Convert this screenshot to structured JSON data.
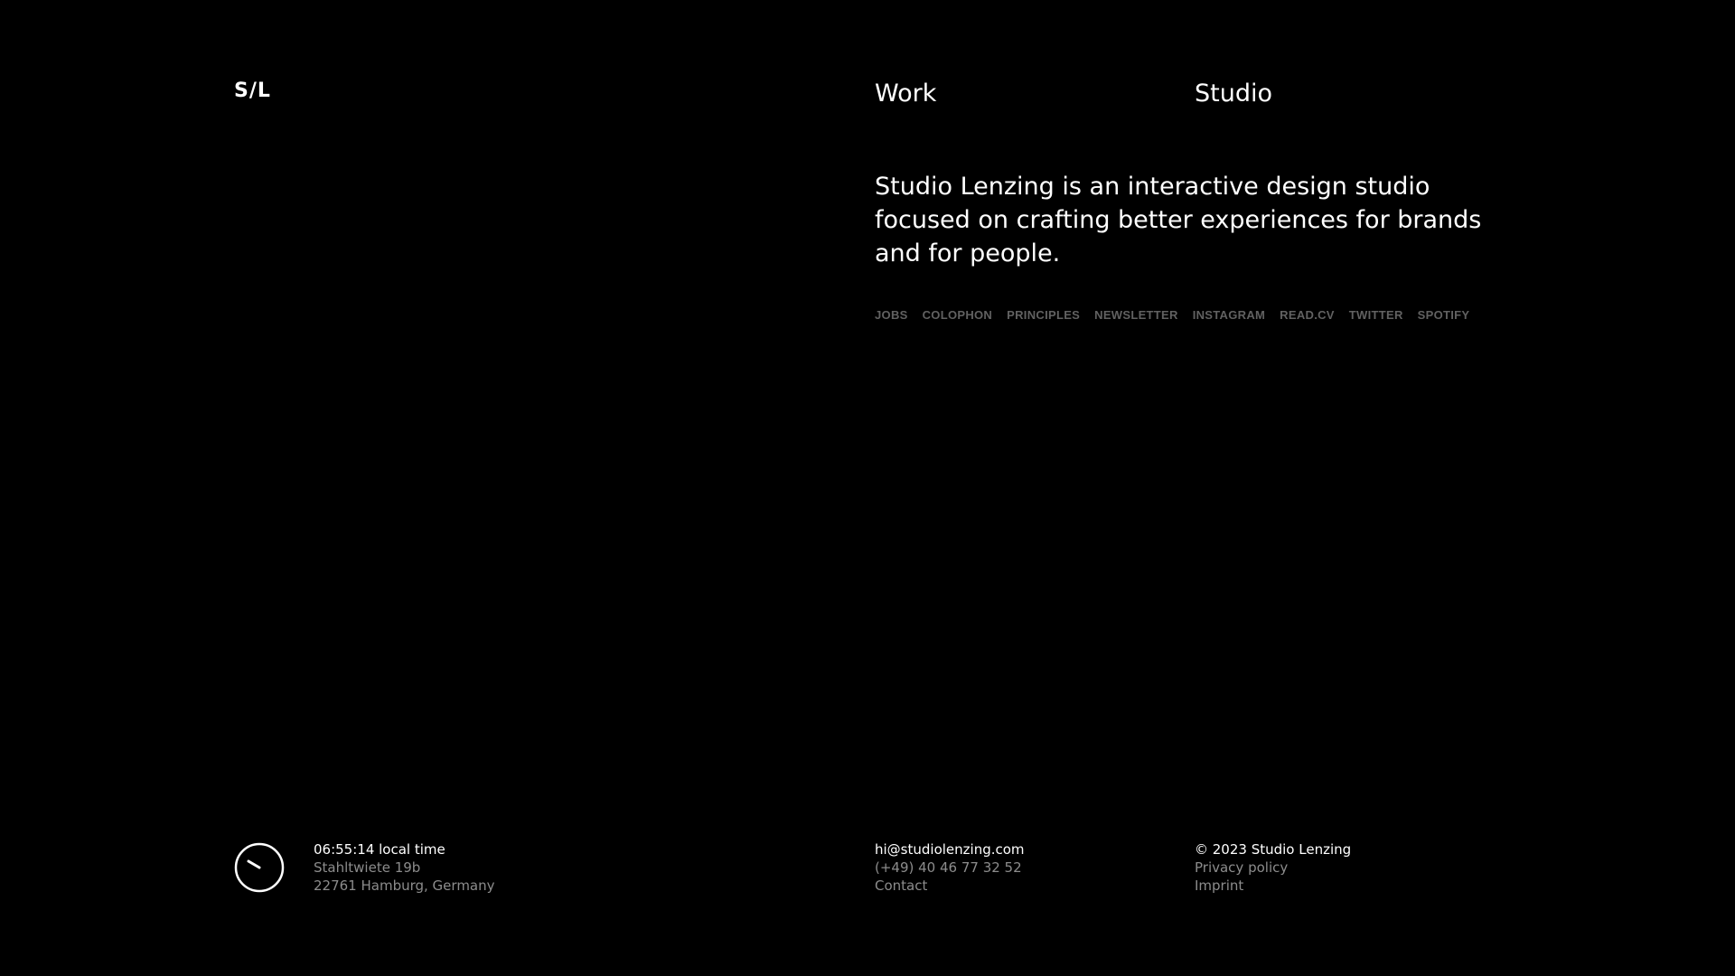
{
  "header": {
    "logo": "S/L",
    "nav": [
      {
        "label": "Work"
      },
      {
        "label": "Studio"
      }
    ]
  },
  "intro": {
    "text": "Studio Lenzing is an interactive design studio focused on crafting better experiences for brands and for people."
  },
  "links": [
    {
      "label": "JOBS"
    },
    {
      "label": "COLOPHON"
    },
    {
      "label": "PRINCIPLES"
    },
    {
      "label": "NEWSLETTER"
    },
    {
      "label": "INSTAGRAM"
    },
    {
      "label": "READ.CV"
    },
    {
      "label": "TWITTER"
    },
    {
      "label": "SPOTIFY"
    }
  ],
  "footer": {
    "clock_icon": "clock-icon",
    "time": "06:55:14 local time",
    "address_line1": "Stahltwiete 19b",
    "address_line2": "22761 Hamburg, Germany",
    "email": "hi@studiolenzing.com",
    "phone": "(+49) 40 46 77 32 52",
    "contact": "Contact",
    "copyright": "© 2023 Studio Lenzing",
    "privacy": "Privacy policy",
    "imprint": "Imprint"
  },
  "colors": {
    "background": "#000000",
    "text": "#ffffff",
    "muted_text": "#8c8c8c",
    "link_muted": "#616161"
  }
}
